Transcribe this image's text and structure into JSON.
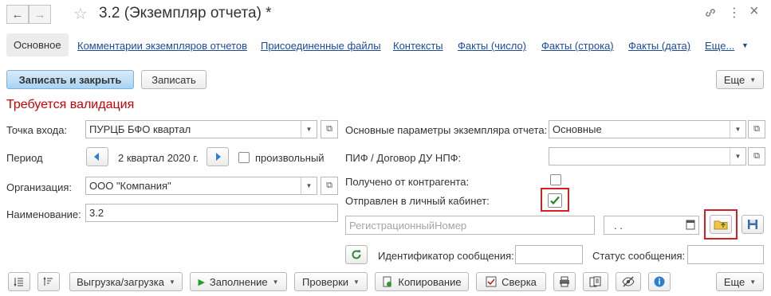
{
  "window": {
    "title": "3.2 (Экземпляр отчета) *",
    "back_glyph": "←",
    "forward_glyph": "→",
    "star_glyph": "☆",
    "link_glyph": "🔗",
    "more_glyph": "⋮",
    "close_glyph": "×"
  },
  "tabs": [
    {
      "label": "Основное",
      "active": true
    },
    {
      "label": "Комментарии экземпляров отчетов"
    },
    {
      "label": "Присоединенные файлы"
    },
    {
      "label": "Контексты"
    },
    {
      "label": "Факты (число)"
    },
    {
      "label": "Факты (строка)"
    },
    {
      "label": "Факты (дата)"
    },
    {
      "label": "Еще..."
    }
  ],
  "toolbar": {
    "save_close": "Записать и закрыть",
    "save": "Записать",
    "more": "Еще"
  },
  "validation_msg": "Требуется валидация",
  "left": {
    "entry_point_label": "Точка входа:",
    "entry_point_value": "ПУРЦБ БФО квартал",
    "period_label": "Период",
    "period_value": "2 квартал 2020 г.",
    "arbitrary_label": "произвольный",
    "org_label": "Организация:",
    "org_value": "ООО \"Компания\"",
    "name_label": "Наименование:",
    "name_value": "3.2"
  },
  "right": {
    "params_label": "Основные параметры экземпляра отчета:",
    "params_value": "Основные",
    "pif_label": "ПИФ / Договор ДУ НПФ:",
    "pif_value": "",
    "received_label": "Получено от контрагента:",
    "sent_label": "Отправлен в личный кабинет:",
    "reg_placeholder": "РегистрационныйНомер",
    "date_value": ". .",
    "msg_id_label": "Идентификатор сообщения:",
    "msg_status_label": "Статус сообщения:"
  },
  "bottom": {
    "export_import": "Выгрузка/загрузка",
    "fill": "Заполнение",
    "checks": "Проверки",
    "copy": "Копирование",
    "reconcile": "Сверка",
    "more": "Еще"
  },
  "colors": {
    "accent_blue": "#1c4a9c",
    "validation_red": "#cc0000",
    "highlight_frame": "#d42020",
    "check_green": "#1a8a2a"
  }
}
